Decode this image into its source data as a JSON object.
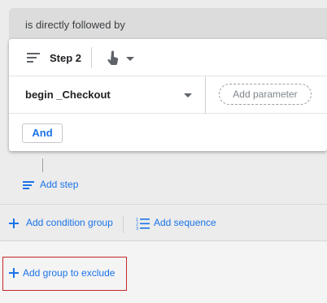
{
  "condition": {
    "header_text": "is directly followed by"
  },
  "step": {
    "label": "Step 2",
    "event_name": "begin _Checkout",
    "add_parameter_label": "Add parameter",
    "and_label": "And"
  },
  "actions": {
    "add_step_label": "Add step",
    "add_condition_group_label": "Add condition group",
    "add_sequence_label": "Add sequence",
    "add_group_to_exclude_label": "Add group to exclude"
  },
  "icons": {
    "step_icon": "step-lines-icon",
    "scope_icon": "hand-pointer-icon",
    "dropdown_icon": "chevron-down-icon",
    "add_icon": "plus-icon",
    "sequence_icon": "sequence-list-icon"
  },
  "colors": {
    "accent": "#1a73e8",
    "highlight_border": "#c62828",
    "background": "#ececec"
  }
}
